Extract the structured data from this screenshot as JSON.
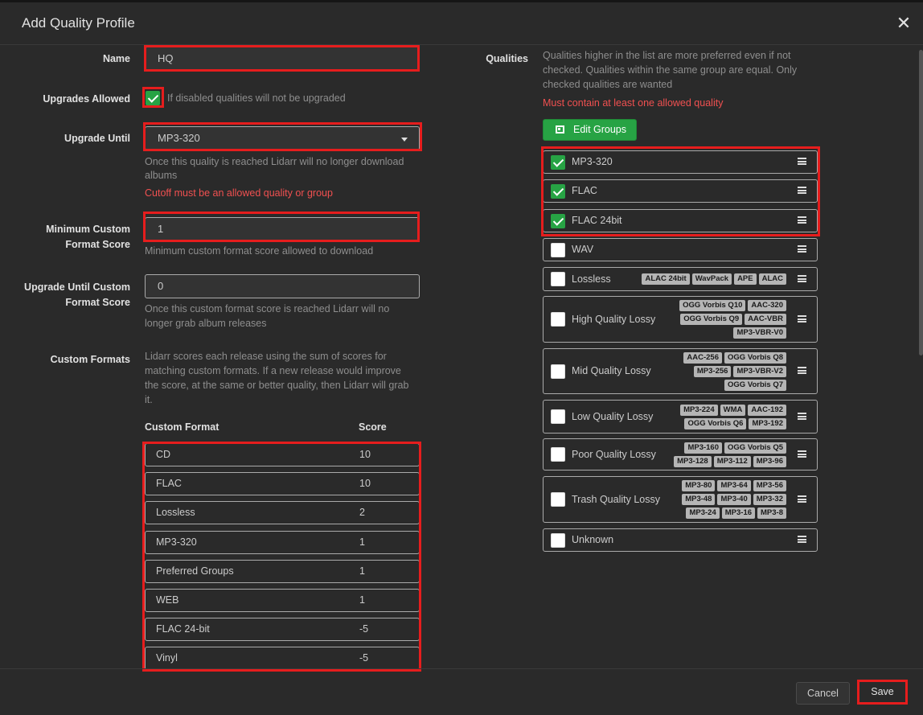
{
  "modal": {
    "title": "Add Quality Profile",
    "close_icon": "✕"
  },
  "form": {
    "name_label": "Name",
    "name_value": "HQ",
    "upgrades_label": "Upgrades Allowed",
    "upgrades_help": "If disabled qualities will not be upgraded",
    "upgrades_checked": true,
    "until_label": "Upgrade Until",
    "until_value": "MP3-320",
    "until_help_1": "Once this quality is reached Lidarr will no longer download",
    "until_help_2": "albums",
    "until_error": "Cutoff must be an allowed quality or group",
    "min_score_label_1": "Minimum Custom",
    "min_score_label_2": "Format Score",
    "min_score_value": "1",
    "min_score_help": "Minimum custom format score allowed to download",
    "until_score_label_1": "Upgrade Until Custom",
    "until_score_label_2": "Format Score",
    "until_score_value": "0",
    "until_score_help_1": "Once this custom format score is reached Lidarr will no",
    "until_score_help_2": "longer grab album releases",
    "cf_label": "Custom Formats",
    "cf_help_1": "Lidarr scores each release using the sum of scores for",
    "cf_help_2": "matching custom formats. If a new release would improve",
    "cf_help_3": "the score, at the same or better quality, then Lidarr will grab",
    "cf_help_4": "it.",
    "cf_col_format": "Custom Format",
    "cf_col_score": "Score",
    "custom_formats": [
      {
        "name": "CD",
        "score": "10"
      },
      {
        "name": "FLAC",
        "score": "10"
      },
      {
        "name": "Lossless",
        "score": "2"
      },
      {
        "name": "MP3-320",
        "score": "1"
      },
      {
        "name": "Preferred Groups",
        "score": "1"
      },
      {
        "name": "WEB",
        "score": "1"
      },
      {
        "name": "FLAC 24-bit",
        "score": "-5"
      },
      {
        "name": "Vinyl",
        "score": "-5"
      }
    ]
  },
  "qualities": {
    "label": "Qualities",
    "help_1": "Qualities higher in the list are more preferred even if not",
    "help_2": "checked. Qualities within the same group are equal. Only",
    "help_3": "checked qualities are wanted",
    "error": "Must contain at least one allowed quality",
    "edit_groups_label": "Edit Groups",
    "items": [
      {
        "name": "MP3-320",
        "checked": true,
        "tags": []
      },
      {
        "name": "FLAC",
        "checked": true,
        "tags": []
      },
      {
        "name": "FLAC 24bit",
        "checked": true,
        "tags": []
      },
      {
        "name": "WAV",
        "checked": false,
        "tags": []
      },
      {
        "name": "Lossless",
        "checked": false,
        "tags": [
          [
            "ALAC 24bit",
            "WavPack",
            "APE",
            "ALAC"
          ]
        ]
      },
      {
        "name": "High Quality Lossy",
        "checked": false,
        "tags": [
          [
            "OGG Vorbis Q10",
            "AAC-320"
          ],
          [
            "OGG Vorbis Q9",
            "AAC-VBR"
          ],
          [
            "MP3-VBR-V0"
          ]
        ]
      },
      {
        "name": "Mid Quality Lossy",
        "checked": false,
        "tags": [
          [
            "AAC-256",
            "OGG Vorbis Q8"
          ],
          [
            "MP3-256",
            "MP3-VBR-V2"
          ],
          [
            "OGG Vorbis Q7"
          ]
        ]
      },
      {
        "name": "Low Quality Lossy",
        "checked": false,
        "tags": [
          [
            "MP3-224",
            "WMA",
            "AAC-192"
          ],
          [
            "OGG Vorbis Q6",
            "MP3-192"
          ]
        ]
      },
      {
        "name": "Poor Quality Lossy",
        "checked": false,
        "tags": [
          [
            "MP3-160",
            "OGG Vorbis Q5"
          ],
          [
            "MP3-128",
            "MP3-112",
            "MP3-96"
          ]
        ]
      },
      {
        "name": "Trash Quality Lossy",
        "checked": false,
        "tags": [
          [
            "MP3-80",
            "MP3-64",
            "MP3-56"
          ],
          [
            "MP3-48",
            "MP3-40",
            "MP3-32"
          ],
          [
            "MP3-24",
            "MP3-16",
            "MP3-8"
          ]
        ]
      },
      {
        "name": "Unknown",
        "checked": false,
        "tags": []
      }
    ]
  },
  "footer": {
    "cancel_label": "Cancel",
    "save_label": "Save"
  },
  "colors": {
    "highlight": "#e61d1d",
    "accent": "#27a344",
    "error": "#f05050"
  },
  "icons": {
    "close": "close-icon",
    "dropdown": "chevron-down-icon",
    "edit_groups": "group-icon",
    "drag": "drag-handle-icon"
  }
}
